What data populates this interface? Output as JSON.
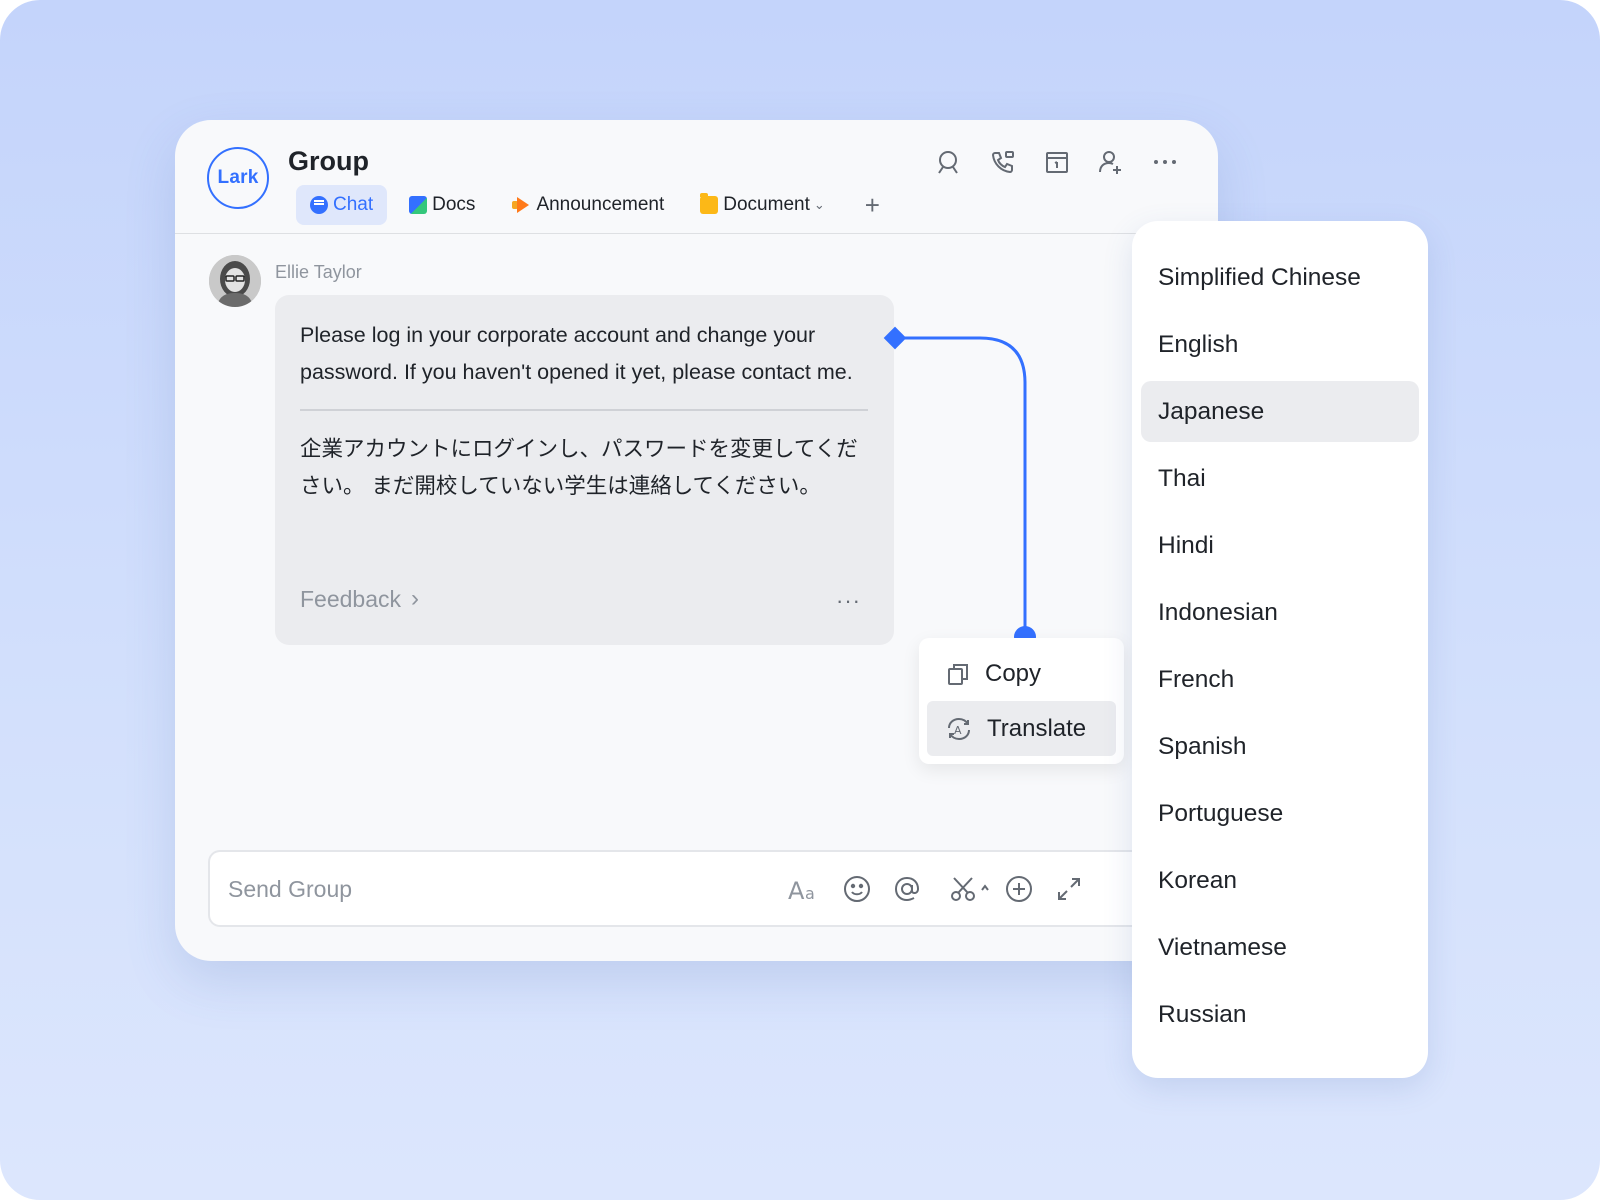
{
  "app": {
    "logo_text": "Lark",
    "chat_title": "Group"
  },
  "tabs": [
    {
      "label": "Chat",
      "icon": "chat-icon",
      "active": true
    },
    {
      "label": "Docs",
      "icon": "docs-icon",
      "active": false
    },
    {
      "label": "Announcement",
      "icon": "announcement-icon",
      "active": false
    },
    {
      "label": "Document",
      "icon": "folder-icon",
      "active": false,
      "has_dropdown": true
    }
  ],
  "tab_add_symbol": "+",
  "header_icons": [
    "search-icon",
    "call-icon",
    "calendar-icon",
    "add-member-icon",
    "more-icon"
  ],
  "message": {
    "sender": "Ellie Taylor",
    "text": "Please log in your corporate account and change your password. If you haven't opened it yet, please contact me.",
    "translation": "企業アカウントにログインし、パスワードを変更してください。 まだ開校していない学生は連絡してください。",
    "feedback_label": "Feedback",
    "more_symbol": "···"
  },
  "context_menu": {
    "items": [
      {
        "label": "Copy",
        "icon": "copy-icon"
      },
      {
        "label": "Translate",
        "icon": "translate-icon",
        "selected": true
      }
    ]
  },
  "composer": {
    "placeholder": "Send Group",
    "tools": [
      "font-icon",
      "emoji-icon",
      "mention-icon",
      "screenshot-icon",
      "add-icon",
      "expand-icon"
    ]
  },
  "languages": {
    "selected": "Japanese",
    "items": [
      "Simplified Chinese",
      "English",
      "Japanese",
      "Thai",
      "Hindi",
      "Indonesian",
      "French",
      "Spanish",
      "Portuguese",
      "Korean",
      "Vietnamese",
      "Russian"
    ]
  },
  "colors": {
    "accent": "#3370ff",
    "background_top": "#c4d4fb",
    "selected_bg": "#ebecef"
  }
}
